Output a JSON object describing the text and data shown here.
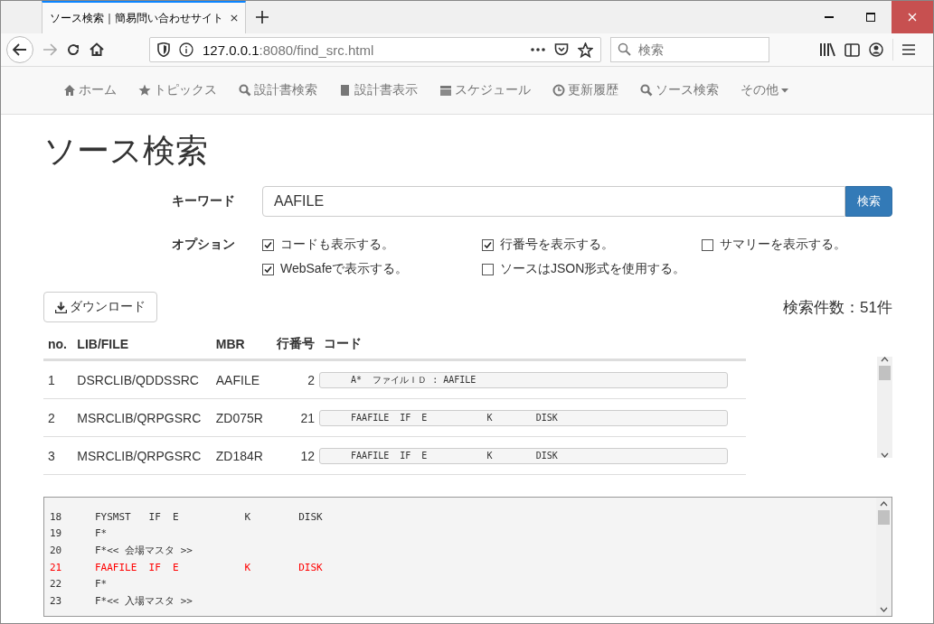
{
  "browser": {
    "tab_title": "ソース検索｜簡易問い合わせサイト",
    "url_host": "127.0.0.1",
    "url_rest": ":8080/find_src.html",
    "search_placeholder": "検索"
  },
  "nav": {
    "items": [
      {
        "label": "ホーム"
      },
      {
        "label": "トピックス"
      },
      {
        "label": "設計書検索"
      },
      {
        "label": "設計書表示"
      },
      {
        "label": "スケジュール"
      },
      {
        "label": "更新履歴"
      },
      {
        "label": "ソース検索"
      },
      {
        "label": "その他"
      }
    ]
  },
  "page_title": "ソース検索",
  "keyword": {
    "label": "キーワード",
    "value": "AAFILE",
    "button": "検索"
  },
  "options": {
    "label": "オプション",
    "items": [
      {
        "label": "コードも表示する。",
        "checked": true
      },
      {
        "label": "行番号を表示する。",
        "checked": true
      },
      {
        "label": "サマリーを表示する。",
        "checked": false
      },
      {
        "label": "WebSafeで表示する。",
        "checked": true
      },
      {
        "label": "ソースはJSON形式を使用する。",
        "checked": false
      }
    ]
  },
  "download_button": "ダウンロード",
  "result_count": "検索件数：51件",
  "table": {
    "columns": [
      "no.",
      "LIB/FILE",
      "MBR",
      "行番号",
      "コード"
    ],
    "rows": [
      {
        "no": "1",
        "file": "DSRCLIB/QDDSSRC",
        "member": "AAFILE",
        "line": "2",
        "code": "     A*  ファイルＩＤ : AAFILE"
      },
      {
        "no": "2",
        "file": "MSRCLIB/QRPGSRC",
        "member": "ZD075R",
        "line": "21",
        "code": "     FAAFILE  IF  E           K        DISK"
      },
      {
        "no": "3",
        "file": "MSRCLIB/QRPGSRC",
        "member": "ZD184R",
        "line": "12",
        "code": "     FAAFILE  IF  E           K        DISK"
      }
    ]
  },
  "source": {
    "lines": [
      {
        "no": "18",
        "text": "FYSMST   IF  E           K        DISK",
        "highlighted": false
      },
      {
        "no": "19",
        "text": "F*",
        "highlighted": false
      },
      {
        "no": "20",
        "text": "F*<< 会場マスタ >>",
        "highlighted": false
      },
      {
        "no": "21",
        "text": "FAAFILE  IF  E           K        DISK",
        "highlighted": true
      },
      {
        "no": "22",
        "text": "F*",
        "highlighted": false
      },
      {
        "no": "23",
        "text": "F*<< 入場マスタ >>",
        "highlighted": false
      }
    ]
  }
}
